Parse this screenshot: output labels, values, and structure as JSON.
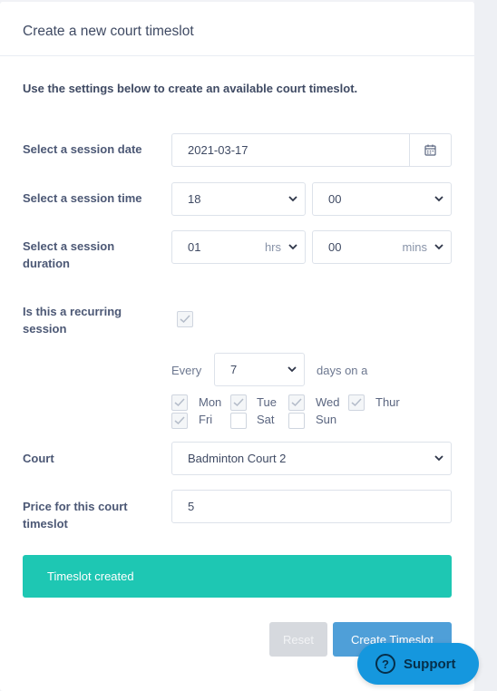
{
  "header": {
    "title": "Create a new court timeslot"
  },
  "intro": "Use the settings below to create an available court timeslot.",
  "session_date": {
    "label": "Select a session date",
    "value": "2021-03-17",
    "icon": "calendar-icon"
  },
  "session_time": {
    "label": "Select a session time",
    "hour": "18",
    "minute": "00"
  },
  "session_duration": {
    "label_line1": "Select a session",
    "label_line2": "duration",
    "hours": "01",
    "hours_unit": "hrs",
    "minutes": "00",
    "minutes_unit": "mins"
  },
  "recurring": {
    "label_line1": "Is this a recurring",
    "label_line2": "session",
    "checked": true
  },
  "every": {
    "prefix": "Every",
    "value": "7",
    "suffix": "days on a"
  },
  "days": [
    {
      "label": "Mon",
      "checked": true
    },
    {
      "label": "Tue",
      "checked": true
    },
    {
      "label": "Wed",
      "checked": true
    },
    {
      "label": "Thur",
      "checked": true
    },
    {
      "label": "Fri",
      "checked": true
    },
    {
      "label": "Sat",
      "checked": false
    },
    {
      "label": "Sun",
      "checked": false
    }
  ],
  "court": {
    "label": "Court",
    "value": "Badminton Court 2"
  },
  "price": {
    "label_line1": "Price for this court",
    "label_line2": "timeslot",
    "value": "5"
  },
  "alert": {
    "text": "Timeslot created",
    "color": "#1ec7b3"
  },
  "buttons": {
    "reset": "Reset",
    "create": "Create Timeslot"
  },
  "support": {
    "label": "Support",
    "icon_glyph": "?"
  }
}
